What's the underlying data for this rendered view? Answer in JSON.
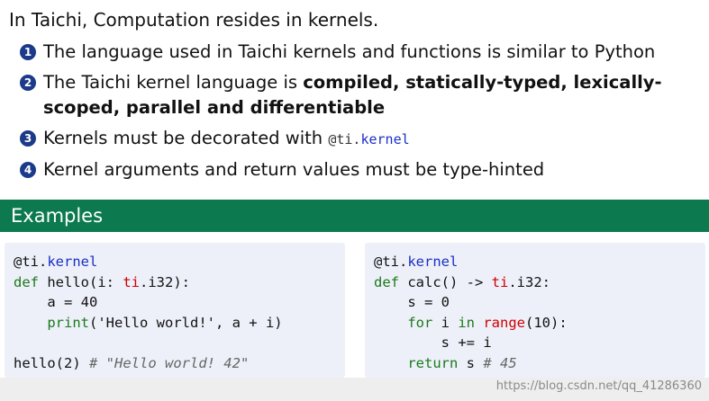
{
  "intro": "In Taichi, Computation resides in kernels.",
  "bullets": [
    {
      "num": "1",
      "text": "The language used in Taichi kernels and functions is similar to Python"
    },
    {
      "num": "2",
      "pre": "The Taichi kernel language is ",
      "bold": "compiled, statically-typed, lexically-scoped, parallel and differentiable"
    },
    {
      "num": "3",
      "pre": "Kernels must be decorated with ",
      "code_prefix": "@ti.",
      "code_kw": "kernel"
    },
    {
      "num": "4",
      "text": "Kernel arguments and return values must be type-hinted"
    }
  ],
  "examples_title": "Examples",
  "code_left": [
    [
      "@ti.",
      "kernel"
    ],
    [
      "def hello(i: ",
      "ti",
      ".i32):"
    ],
    [
      "    a = 40"
    ],
    [
      "    ",
      "print",
      "('Hello world!', a + i)"
    ],
    [
      ""
    ],
    [
      "hello(2) ",
      "# \"Hello world! 42\""
    ]
  ],
  "code_right": [
    [
      "@ti.",
      "kernel"
    ],
    [
      "def calc() -> ",
      "ti",
      ".i32:"
    ],
    [
      "    s = 0"
    ],
    [
      "    ",
      "for",
      " i ",
      "in",
      " ",
      "range",
      "(10):"
    ],
    [
      "        s += i"
    ],
    [
      "    ",
      "return",
      " s ",
      "# 45"
    ]
  ],
  "watermark": "https://blog.csdn.net/qq_41286360"
}
